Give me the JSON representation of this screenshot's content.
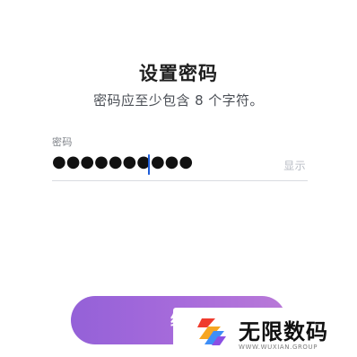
{
  "form": {
    "title": "设置密码",
    "subtitle": "密码应至少包含 8 个字符。",
    "field_label": "密码",
    "password_mask": "●●●●●●●●●●",
    "show_label": "显示"
  },
  "actions": {
    "continue_label": "继"
  },
  "watermark": {
    "title": "无限数码",
    "subtitle": "WWW.WUXIAN.GROUP"
  },
  "colors": {
    "button_start": "#9461d8",
    "button_end": "#b979d8",
    "caret": "#1b5bd8",
    "logo_red": "#ef3b2d",
    "logo_orange": "#f6a623",
    "logo_blue": "#3e8ef7",
    "logo_purple": "#8b4fe3"
  }
}
